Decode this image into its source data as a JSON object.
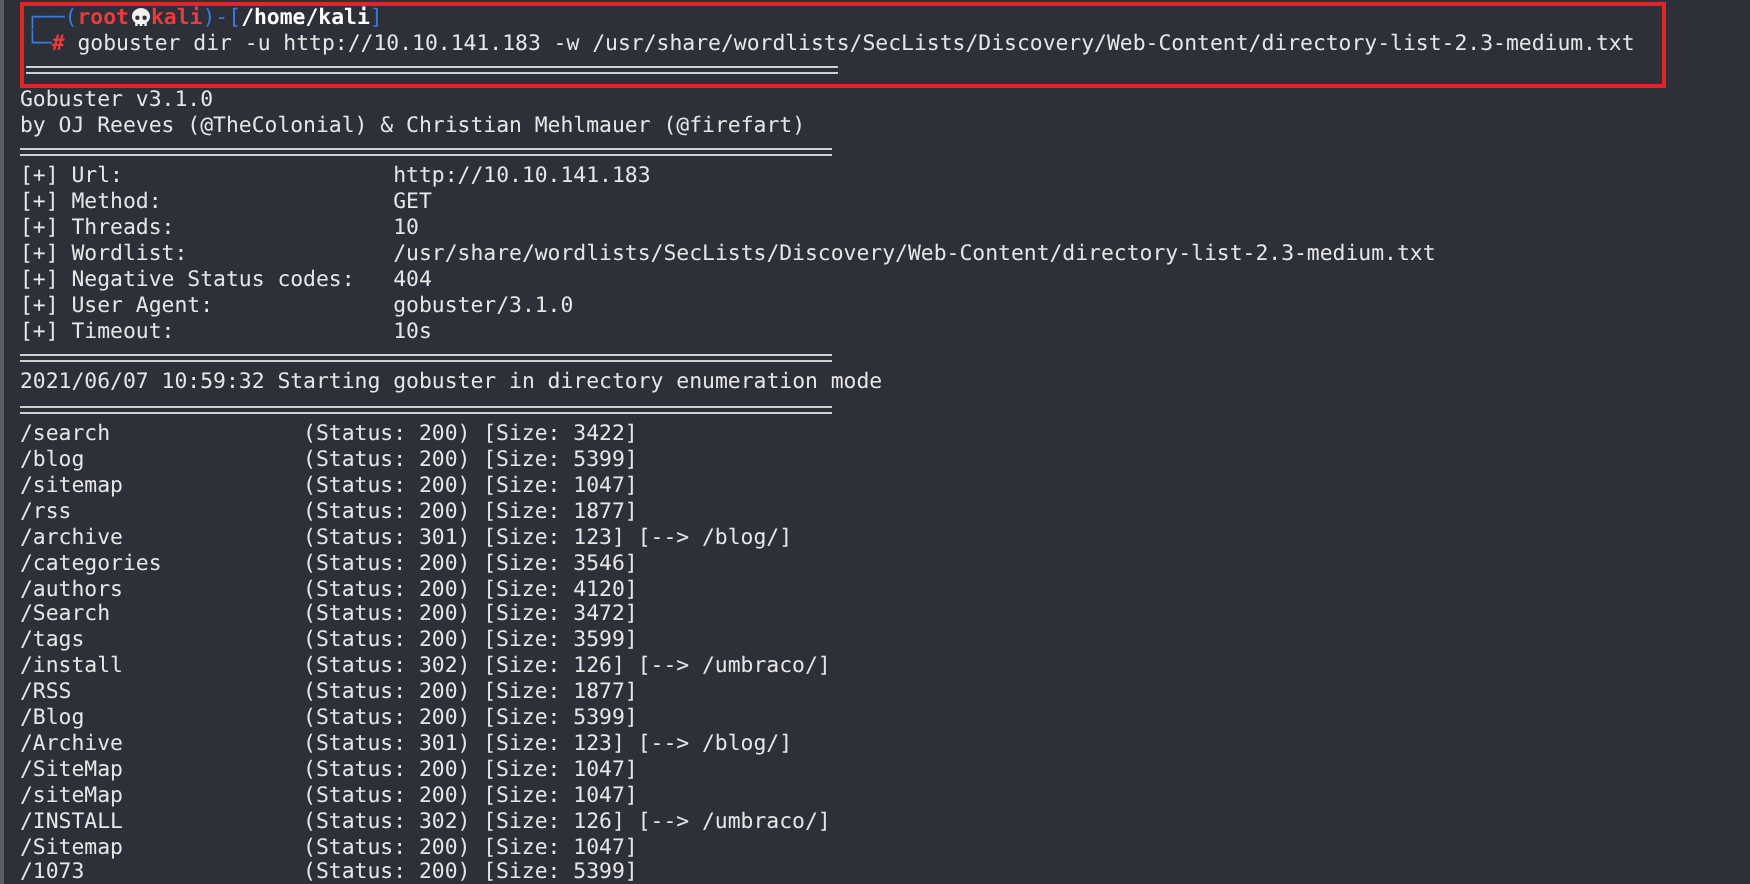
{
  "prompt": {
    "lines": [
      [
        {
          "kind": "frame",
          "text": "┌──("
        },
        {
          "kind": "user",
          "text": "root"
        },
        {
          "kind": "skull"
        },
        {
          "kind": "host",
          "text": "kali"
        },
        {
          "kind": "frame",
          "text": ")-["
        },
        {
          "kind": "path",
          "text": "/home/kali"
        },
        {
          "kind": "frame",
          "text": "]"
        }
      ],
      [
        {
          "kind": "frame",
          "text": "└─"
        },
        {
          "kind": "symbol",
          "text": "#"
        },
        {
          "kind": "command",
          "text": "gobuster dir -u http://10.10.141.183 -w /usr/share/wordlists/SecLists/Discovery/Web-Content/directory-list-2.3-medium.txt"
        }
      ]
    ]
  },
  "banner": [
    "Gobuster v3.1.0",
    "by OJ Reeves (@TheColonial) & Christian Mehlmauer (@firefart)"
  ],
  "settings": [
    {
      "label": "[+] Url:",
      "value": "http://10.10.141.183"
    },
    {
      "label": "[+] Method:",
      "value": "GET"
    },
    {
      "label": "[+] Threads:",
      "value": "10"
    },
    {
      "label": "[+] Wordlist:",
      "value": "/usr/share/wordlists/SecLists/Discovery/Web-Content/directory-list-2.3-medium.txt"
    },
    {
      "label": "[+] Negative Status codes:",
      "value": "404"
    },
    {
      "label": "[+] User Agent:",
      "value": "gobuster/3.1.0"
    },
    {
      "label": "[+] Timeout:",
      "value": "10s"
    }
  ],
  "start_message": "2021/06/07 10:59:32 Starting gobuster in directory enumeration mode",
  "results": [
    {
      "path": "/search",
      "status": "(Status: 200)",
      "size": "[Size: 3422]"
    },
    {
      "path": "/blog",
      "status": "(Status: 200)",
      "size": "[Size: 5399]"
    },
    {
      "path": "/sitemap",
      "status": "(Status: 200)",
      "size": "[Size: 1047]"
    },
    {
      "path": "/rss",
      "status": "(Status: 200)",
      "size": "[Size: 1877]"
    },
    {
      "path": "/archive",
      "status": "(Status: 301)",
      "size": "[Size: 123]",
      "redirect": "[--> /blog/]"
    },
    {
      "path": "/categories",
      "status": "(Status: 200)",
      "size": "[Size: 3546]"
    },
    {
      "path": "/authors",
      "status": "(Status: 200)",
      "size": "[Size: 4120]"
    },
    {
      "path": "/Search",
      "status": "(Status: 200)",
      "size": "[Size: 3472]"
    },
    {
      "path": "/tags",
      "status": "(Status: 200)",
      "size": "[Size: 3599]"
    },
    {
      "path": "/install",
      "status": "(Status: 302)",
      "size": "[Size: 126]",
      "redirect": "[--> /umbraco/]"
    },
    {
      "path": "/RSS",
      "status": "(Status: 200)",
      "size": "[Size: 1877]"
    },
    {
      "path": "/Blog",
      "status": "(Status: 200)",
      "size": "[Size: 5399]"
    },
    {
      "path": "/Archive",
      "status": "(Status: 301)",
      "size": "[Size: 123]",
      "redirect": "[--> /blog/]"
    },
    {
      "path": "/SiteMap",
      "status": "(Status: 200)",
      "size": "[Size: 1047]"
    },
    {
      "path": "/siteMap",
      "status": "(Status: 200)",
      "size": "[Size: 1047]"
    },
    {
      "path": "/INSTALL",
      "status": "(Status: 302)",
      "size": "[Size: 126]",
      "redirect": "[--> /umbraco/]"
    },
    {
      "path": "/Sitemap",
      "status": "(Status: 200)",
      "size": "[Size: 1047]"
    },
    {
      "path": "/1073",
      "status": "(Status: 200)",
      "size": "[Size: 5399]"
    }
  ]
}
